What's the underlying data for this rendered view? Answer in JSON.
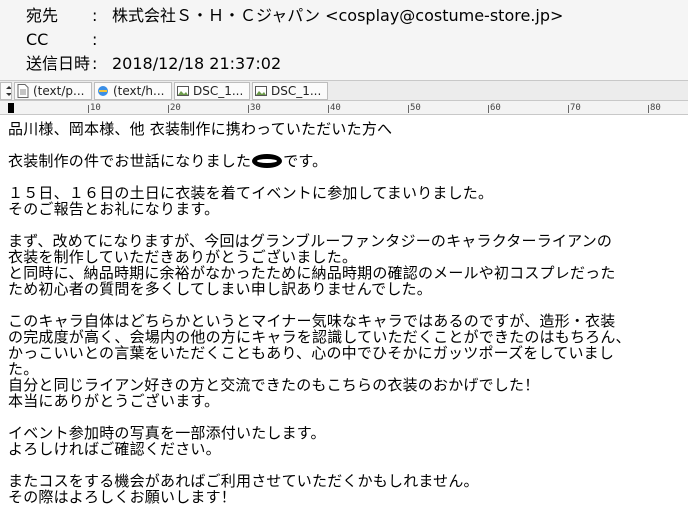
{
  "header": {
    "to_label": "宛先",
    "to_value": "株式会社Ｓ・Ｈ・Ｃジャパン <cosplay@costume-store.jp>",
    "cc_label": "CC",
    "cc_value": "",
    "sent_label": "送信日時",
    "sent_value": "2018/12/18 21:37:02",
    "colon": ":"
  },
  "tabs": [
    {
      "label": "(text/p..."
    },
    {
      "label": "(text/h..."
    },
    {
      "label": "DSC_1..."
    },
    {
      "label": "DSC_1..."
    }
  ],
  "ruler": {
    "marks": [
      "10",
      "20",
      "30",
      "40",
      "50",
      "60",
      "70",
      "80"
    ]
  },
  "message": {
    "l1": "品川様、岡本様、他 衣装制作に携わっていただいた方へ",
    "l2_pre": "衣装制作の件でお世話になりました",
    "l2_post": "です。",
    "l3": "１５日、１６日の土日に衣装を着てイベントに参加してまいりました。",
    "l4": "そのご報告とお礼になります。",
    "l5": "まず、改めてになりますが、今回はグランブルーファンタジーのキャラクターライアンの",
    "l6": "衣装を制作していただきありがとうございました。",
    "l7": "と同時に、納品時期に余裕がなかったために納品時期の確認のメールや初コスプレだった",
    "l8": "ため初心者の質問を多くしてしまい申し訳ありませんでした。",
    "l9": "このキャラ自体はどちらかというとマイナー気味なキャラではあるのですが、造形・衣装",
    "l10": "の完成度が高く、会場内の他の方にキャラを認識していただくことができたのはもちろん、",
    "l11": "かっこいいとの言葉をいただくこともあり、心の中でひそかにガッツポーズをしていまし",
    "l12": "た。",
    "l13": "自分と同じライアン好きの方と交流できたのもこちらの衣装のおかげでした！",
    "l14": "本当にありがとうございます。",
    "l15": "イベント参加時の写真を一部添付いたします。",
    "l16": "よろしければご確認ください。",
    "l17": "またコスをする機会があればご利用させていただくかもしれません。",
    "l18": "その際はよろしくお願いします！"
  }
}
